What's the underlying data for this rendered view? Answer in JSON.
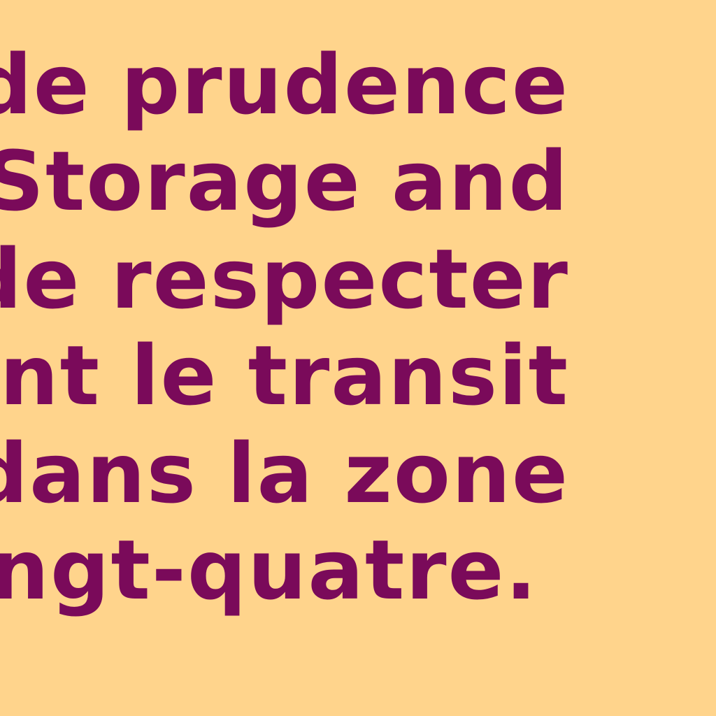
{
  "colors": {
    "background": "#FFD48C",
    "text": "#7A0A5A"
  },
  "document": {
    "lines": [
      "ne de prudence",
      "Storage and",
      "et de respecter",
      "ndant le transit",
      "s dans la zone",
      "ngt-quatre."
    ]
  }
}
